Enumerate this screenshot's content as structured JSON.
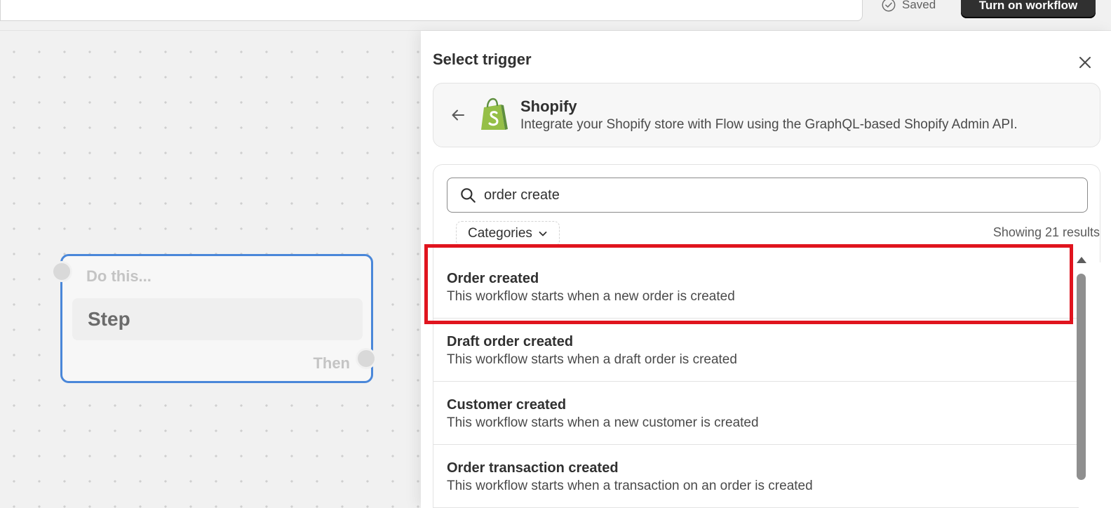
{
  "topbar": {
    "saved_label": "Saved",
    "turn_on_label": "Turn on workflow"
  },
  "canvas": {
    "step_card": {
      "do_this": "Do this...",
      "step_label": "Step",
      "then_label": "Then"
    }
  },
  "panel": {
    "title": "Select trigger",
    "app": {
      "name": "Shopify",
      "description": "Integrate your Shopify store with Flow using the GraphQL-based Shopify Admin API.",
      "logo_color": "#95bf47"
    },
    "search": {
      "value": "order create",
      "placeholder": "Search"
    },
    "categories_label": "Categories",
    "results_count": "Showing 21 results",
    "items": [
      {
        "title": "Order created",
        "description": "This workflow starts when a new order is created"
      },
      {
        "title": "Draft order created",
        "description": "This workflow starts when a draft order is created"
      },
      {
        "title": "Customer created",
        "description": "This workflow starts when a new customer is created"
      },
      {
        "title": "Order transaction created",
        "description": "This workflow starts when a transaction on an order is created"
      }
    ]
  },
  "colors": {
    "accent_blue": "#4a87d9",
    "highlight_red": "#e0141e",
    "primary_button": "#303030"
  }
}
